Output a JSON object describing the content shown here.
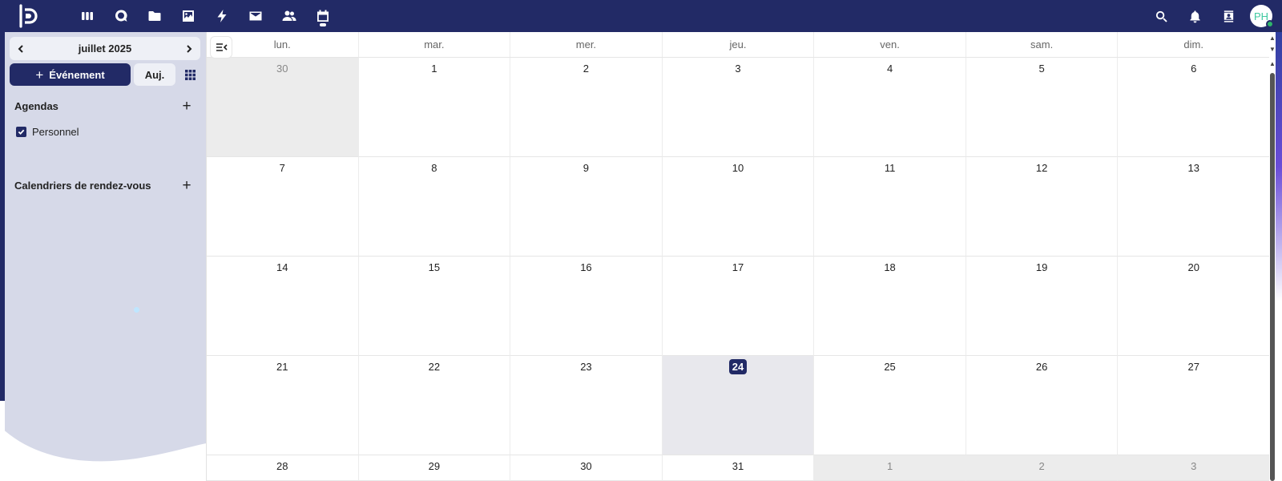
{
  "topbar": {
    "apps": [
      {
        "name": "dashboard",
        "icon": "dashboard-icon"
      },
      {
        "name": "talk",
        "icon": "talk-icon"
      },
      {
        "name": "files",
        "icon": "folder-icon"
      },
      {
        "name": "photos",
        "icon": "image-icon"
      },
      {
        "name": "activity",
        "icon": "lightning-icon"
      },
      {
        "name": "mail",
        "icon": "mail-icon"
      },
      {
        "name": "contacts",
        "icon": "people-icon"
      },
      {
        "name": "calendar",
        "icon": "calendar-icon",
        "active": true
      }
    ],
    "avatar_initials": "PH",
    "accent_color": "#222a66"
  },
  "sidebar": {
    "month_label": "juillet 2025",
    "new_event_label": "Événement",
    "today_label": "Auj.",
    "agendas_title": "Agendas",
    "calendars": [
      {
        "label": "Personnel",
        "checked": true
      }
    ],
    "appointments_title": "Calendriers de rendez-vous"
  },
  "calendar": {
    "weekdays": [
      "lun.",
      "mar.",
      "mer.",
      "jeu.",
      "ven.",
      "sam.",
      "dim."
    ],
    "weeks": [
      [
        {
          "d": "30",
          "other": true
        },
        {
          "d": "1"
        },
        {
          "d": "2"
        },
        {
          "d": "3"
        },
        {
          "d": "4"
        },
        {
          "d": "5"
        },
        {
          "d": "6"
        }
      ],
      [
        {
          "d": "7"
        },
        {
          "d": "8"
        },
        {
          "d": "9"
        },
        {
          "d": "10"
        },
        {
          "d": "11"
        },
        {
          "d": "12"
        },
        {
          "d": "13"
        }
      ],
      [
        {
          "d": "14"
        },
        {
          "d": "15"
        },
        {
          "d": "16"
        },
        {
          "d": "17"
        },
        {
          "d": "18"
        },
        {
          "d": "19"
        },
        {
          "d": "20"
        }
      ],
      [
        {
          "d": "21"
        },
        {
          "d": "22"
        },
        {
          "d": "23"
        },
        {
          "d": "24",
          "today": true
        },
        {
          "d": "25"
        },
        {
          "d": "26"
        },
        {
          "d": "27"
        }
      ],
      [
        {
          "d": "28"
        },
        {
          "d": "29"
        },
        {
          "d": "30"
        },
        {
          "d": "31"
        },
        {
          "d": "1",
          "other": true
        },
        {
          "d": "2",
          "other": true
        },
        {
          "d": "3",
          "other": true
        }
      ]
    ]
  }
}
